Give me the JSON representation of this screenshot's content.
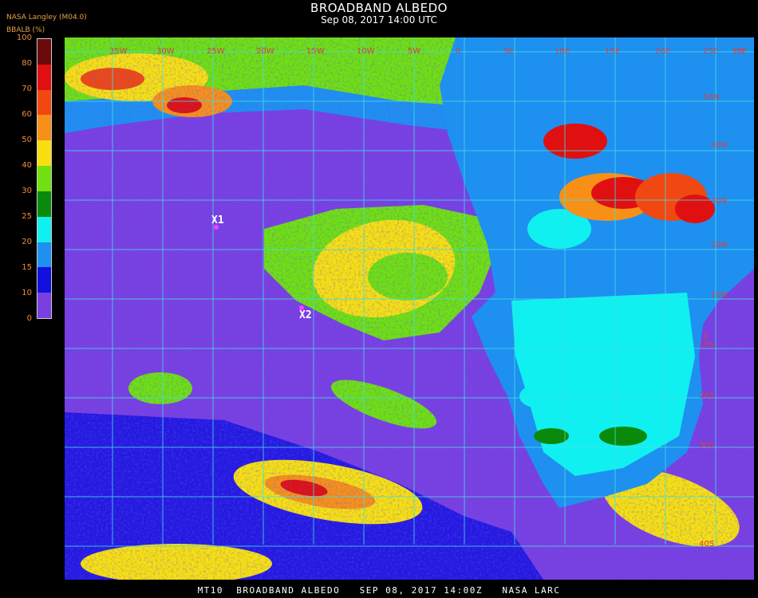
{
  "header": {
    "title": "BROADBAND ALBEDO",
    "subtitle": "Sep 08, 2017 14:00 UTC",
    "producer": "NASA Langley (M04.0)",
    "units": "BBALB (%)"
  },
  "colorbar": {
    "labels": [
      "100",
      "80",
      "70",
      "60",
      "50",
      "40",
      "30",
      "25",
      "20",
      "15",
      "10",
      "0"
    ],
    "segments": [
      {
        "color": "#6a0a0a"
      },
      {
        "color": "#e01010"
      },
      {
        "color": "#f04810"
      },
      {
        "color": "#f89018"
      },
      {
        "color": "#f8e010"
      },
      {
        "color": "#70e010"
      },
      {
        "color": "#0a8a0a"
      },
      {
        "color": "#10f0f0"
      },
      {
        "color": "#1e90f0"
      },
      {
        "color": "#1010e0"
      },
      {
        "color": "#7a3fe0"
      }
    ]
  },
  "map": {
    "markers": [
      {
        "label": "X1"
      },
      {
        "label": "X2"
      }
    ],
    "grid_labels": [
      "50N",
      "40N",
      "30N",
      "20N",
      "10N",
      "0",
      "10S",
      "20S",
      "30S",
      "40S",
      "35W",
      "30W",
      "25W",
      "20W",
      "15W",
      "10W",
      "5W",
      "0",
      "5E",
      "10E",
      "15E",
      "20E",
      "25E",
      "30E",
      "35E"
    ],
    "colors": {
      "ocean": "#7a3fe0",
      "land": "#1e90f0",
      "desert": "#10f0f0",
      "grid": "#40e0e0",
      "marker": "#ff40ff"
    }
  },
  "footer": {
    "text": "MT10  BROADBAND ALBEDO   SEP 08, 2017 14:00Z   NASA LARC"
  }
}
